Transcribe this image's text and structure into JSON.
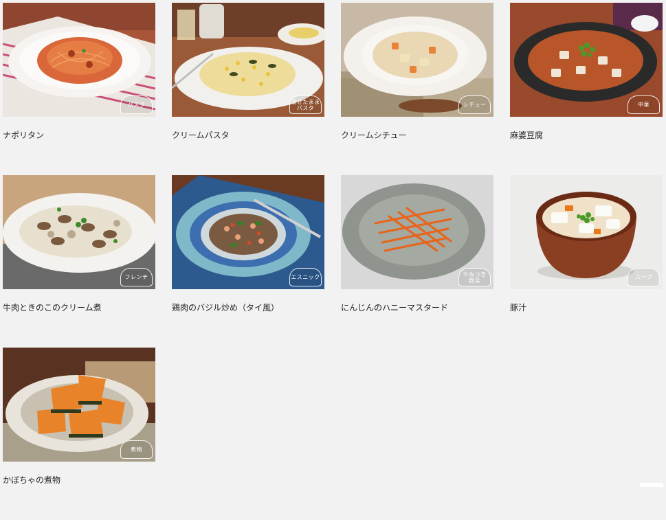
{
  "recipes": [
    {
      "title": "ナポリタン",
      "badge": "パスタ"
    },
    {
      "title": "クリームパスタ",
      "badge": "混ぜたまま\nパスタ"
    },
    {
      "title": "クリームシチュー",
      "badge": "シチュー"
    },
    {
      "title": "麻婆豆腐",
      "badge": "中華"
    },
    {
      "title": "牛肉ときのこのクリーム煮",
      "badge": "フレンチ"
    },
    {
      "title": "鶏肉のバジル炒め（タイ風）",
      "badge": "エスニック"
    },
    {
      "title": "にんじんのハニーマスタード",
      "badge": "やみつき\n野菜"
    },
    {
      "title": "豚汁",
      "badge": "スープ"
    },
    {
      "title": "かぼちゃの煮物",
      "badge": "煮物"
    }
  ]
}
